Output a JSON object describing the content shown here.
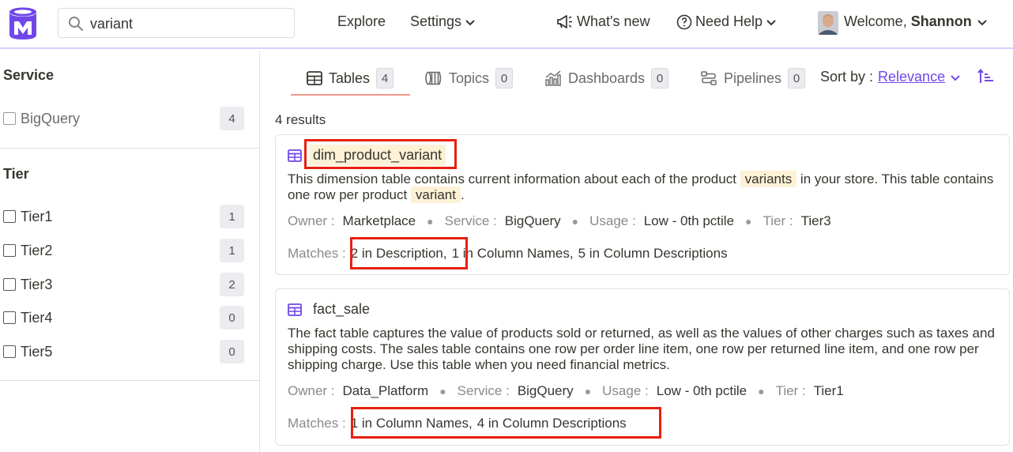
{
  "header": {
    "search_value": "variant",
    "nav": {
      "explore": "Explore",
      "settings": "Settings"
    },
    "whats_new": "What's new",
    "need_help": "Need Help",
    "welcome_prefix": "Welcome, ",
    "user_name": "Shannon"
  },
  "sidebar": {
    "service": {
      "title": "Service",
      "items": [
        {
          "label": "BigQuery",
          "count": "4"
        }
      ]
    },
    "tier": {
      "title": "Tier",
      "items": [
        {
          "label": "Tier1",
          "count": "1"
        },
        {
          "label": "Tier2",
          "count": "1"
        },
        {
          "label": "Tier3",
          "count": "2"
        },
        {
          "label": "Tier4",
          "count": "0"
        },
        {
          "label": "Tier5",
          "count": "0"
        }
      ]
    }
  },
  "tabs": [
    {
      "label": "Tables",
      "count": "4",
      "icon": "table-icon"
    },
    {
      "label": "Topics",
      "count": "0",
      "icon": "topics-icon"
    },
    {
      "label": "Dashboards",
      "count": "0",
      "icon": "dashboard-icon"
    },
    {
      "label": "Pipelines",
      "count": "0",
      "icon": "pipeline-icon"
    }
  ],
  "sort": {
    "label": "Sort by :",
    "value": "Relevance"
  },
  "results_count": "4 results",
  "cards": [
    {
      "title": "dim_product_variant",
      "description": {
        "p1": "This dimension table contains current information about each of the product ",
        "h1": "variants",
        "p2": " in your store. This table contains one row per product ",
        "h2": "variant",
        "p3": "."
      },
      "owner_label": "Owner :",
      "owner": "Marketplace",
      "service_label": "Service :",
      "service": "BigQuery",
      "usage_label": "Usage :",
      "usage": "Low - 0th pctile",
      "tier_label": "Tier :",
      "tier": "Tier3",
      "matches_label": "Matches :",
      "matches": [
        "2 in Description,",
        "1 in Column Names,",
        "5 in Column Descriptions"
      ]
    },
    {
      "title": "fact_sale",
      "description": {
        "p1": "The fact table captures the value of products sold or returned, as well as the values of other charges such as taxes and shipping costs. The sales table contains one row per order line item, one row per returned line item, and one row per shipping charge. Use this table when you need financial metrics."
      },
      "owner_label": "Owner :",
      "owner": "Data_Platform",
      "service_label": "Service :",
      "service": "BigQuery",
      "usage_label": "Usage :",
      "usage": "Low - 0th pctile",
      "tier_label": "Tier :",
      "tier": "Tier1",
      "matches_label": "Matches :",
      "matches": [
        "1 in Column Names,",
        "4 in Column Descriptions"
      ]
    }
  ],
  "colors": {
    "accent": "#7147e8",
    "highlight": "#fdf1d6",
    "annotation": "#e8200e"
  }
}
